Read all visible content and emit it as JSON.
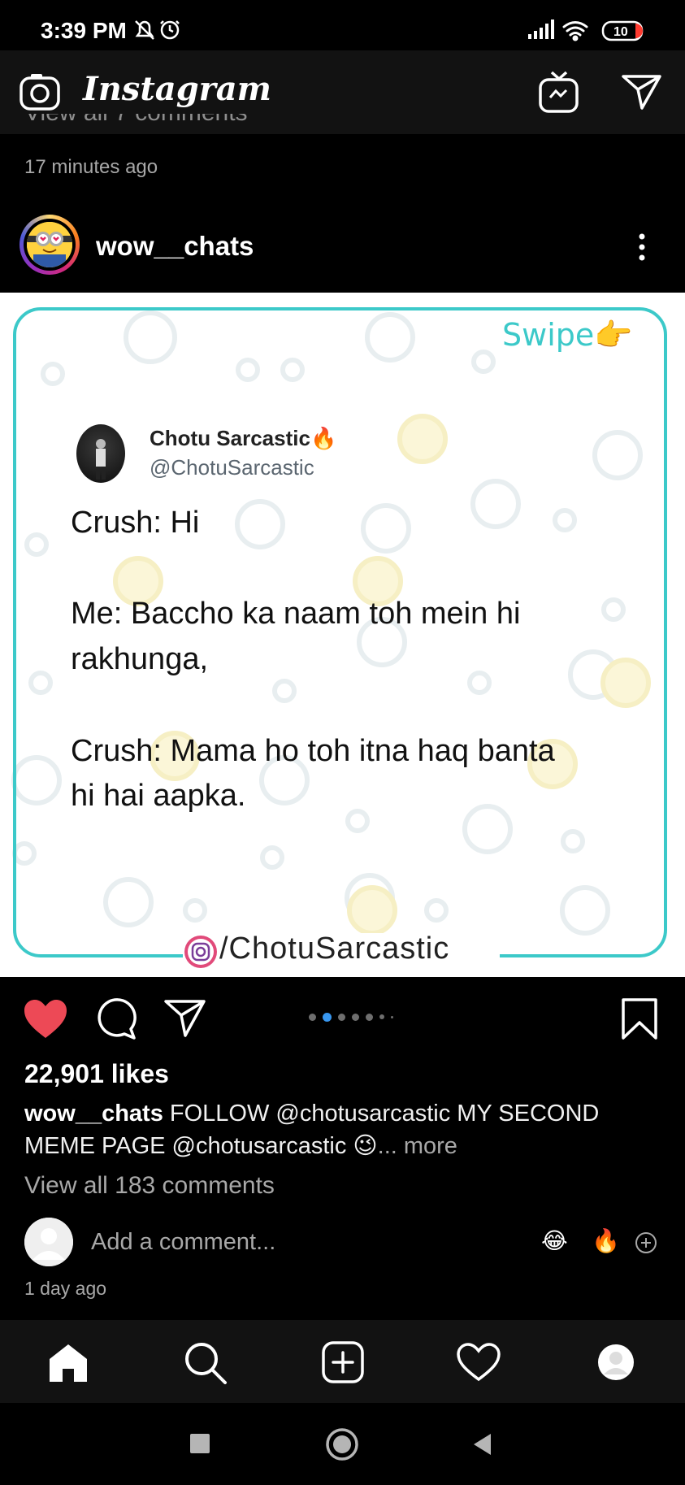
{
  "status_bar": {
    "time": "3:39 PM",
    "battery": "10"
  },
  "app_bar": {
    "brand": "Instagram"
  },
  "previous_post": {
    "comments_cut_off": "View all 7 comments",
    "time_ago": "17 minutes ago"
  },
  "post": {
    "username": "wow__chats",
    "image": {
      "swipe_label": "Swipe",
      "tweet_author_name": "Chotu Sarcastic",
      "tweet_author_handle": "@ChotuSarcastic",
      "tweet_lines": [
        "Crush: Hi",
        "Me: Baccho ka naam toh mein hi",
        "rakhunga,",
        "Crush: Mama ho toh itna haq banta",
        "hi hai aapka."
      ],
      "watermark": "/ChotuSarcastic"
    },
    "carousel": {
      "count": 7,
      "active_index": 1
    },
    "likes": "22,901 likes",
    "caption_username": "wow__chats",
    "caption_text": " FOLLOW @chotusarcastic MY SECOND MEME PAGE @chotusarcastic 😉",
    "caption_more": "... more",
    "view_all_comments": "View all 183 comments",
    "comment_placeholder": "Add a comment...",
    "quick_reactions": [
      "😂",
      "🔥"
    ],
    "time_ago": "1 day ago"
  },
  "icons": {
    "status": [
      "dnd-icon",
      "alarm-icon",
      "signal-icon",
      "wifi-icon",
      "battery-icon"
    ],
    "app_bar": [
      "camera-icon",
      "igtv-icon",
      "direct-message-icon"
    ],
    "post_actions": [
      "like-icon",
      "comment-icon",
      "share-icon",
      "save-icon"
    ],
    "tabs": [
      "home-icon",
      "search-icon",
      "add-post-icon",
      "activity-icon",
      "profile-icon"
    ],
    "system_nav": [
      "recents-icon",
      "home-button-icon",
      "back-icon"
    ]
  },
  "colors": {
    "like_red": "#ed4956",
    "carousel_active": "#3897f0",
    "card_border": "#3cc9c9"
  }
}
